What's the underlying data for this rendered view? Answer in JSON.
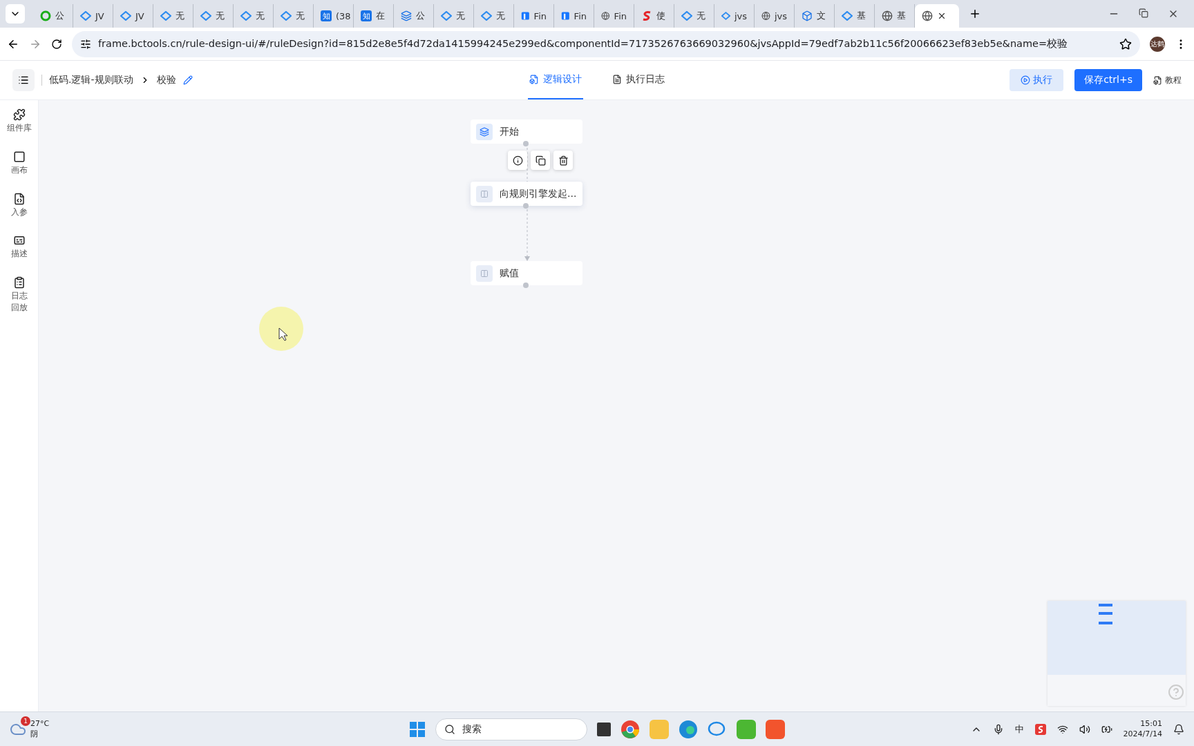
{
  "browser": {
    "tabs": [
      {
        "title": "公",
        "kind": "cloud",
        "selected": false
      },
      {
        "title": "JV",
        "kind": "diamond",
        "selected": false
      },
      {
        "title": "JV",
        "kind": "diamond",
        "selected": false
      },
      {
        "title": "无",
        "kind": "diamond",
        "selected": false
      },
      {
        "title": "无",
        "kind": "diamond",
        "selected": false
      },
      {
        "title": "无",
        "kind": "diamond",
        "selected": false
      },
      {
        "title": "无",
        "kind": "diamond",
        "selected": false
      },
      {
        "title": "(38",
        "kind": "zhi",
        "glyph": "知",
        "selected": false
      },
      {
        "title": "在",
        "kind": "zhi",
        "glyph": "知",
        "selected": false
      },
      {
        "title": "公",
        "kind": "layers",
        "selected": false
      },
      {
        "title": "无",
        "kind": "diamond",
        "selected": false
      },
      {
        "title": "无",
        "kind": "diamond",
        "selected": false
      },
      {
        "title": "Fin",
        "kind": "fin",
        "selected": false
      },
      {
        "title": "Fin",
        "kind": "fin",
        "selected": false
      },
      {
        "title": "Fin",
        "kind": "globe",
        "selected": false
      },
      {
        "title": "使",
        "kind": "s",
        "selected": false
      },
      {
        "title": "无",
        "kind": "diamond",
        "selected": false
      },
      {
        "title": "jvs",
        "kind": "diamond",
        "selected": false
      },
      {
        "title": "jvs",
        "kind": "globe",
        "selected": false
      },
      {
        "title": "文",
        "kind": "cube",
        "selected": false
      },
      {
        "title": "基",
        "kind": "diamond",
        "selected": false
      },
      {
        "title": "基",
        "kind": "globe",
        "selected": false
      },
      {
        "kind": "globe",
        "selected": true
      }
    ],
    "url": "frame.bctools.cn/rule-design-ui/#/ruleDesign?id=815d2e8e5f4d72da1415994245e299ed&componentId=7173526763669032960&jvsAppId=79edf7ab2b11c56f20066623ef83eb5e&name=校验",
    "profile": "达鹤"
  },
  "header": {
    "breadcrumb": [
      "低码.逻辑-规则联动",
      "校验"
    ],
    "tabs": [
      {
        "label": "逻辑设计",
        "selected": true
      },
      {
        "label": "执行日志",
        "selected": false
      }
    ],
    "run_button": "执行",
    "save_button": "保存ctrl+s",
    "tutorial": "教程"
  },
  "sidebar": {
    "items": [
      {
        "label": "组件库",
        "kind": "puzzle"
      },
      {
        "label": "画布",
        "kind": "canvas"
      },
      {
        "label": "入参",
        "kind": "code"
      },
      {
        "label": "描述",
        "kind": "text"
      },
      {
        "label": "日志回放",
        "kind": "log"
      }
    ]
  },
  "canvas": {
    "nodes": [
      {
        "label": "开始",
        "kind": "start",
        "selected": false
      },
      {
        "label": "向规则引擎发起...",
        "kind": "action",
        "selected": true
      },
      {
        "label": "赋值",
        "kind": "action",
        "selected": false
      }
    ]
  },
  "taskbar": {
    "temperature": "27°C",
    "weather": "阴",
    "badge": "1",
    "search": "搜索",
    "ime": "中",
    "time": "15:01",
    "date": "2024/7/14"
  }
}
